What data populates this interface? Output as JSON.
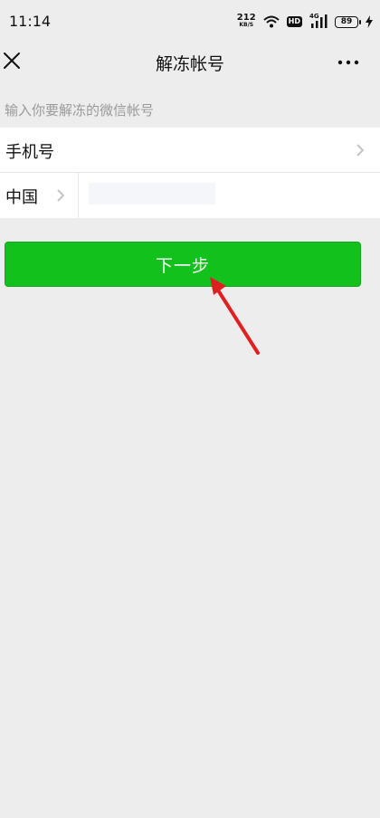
{
  "status_bar": {
    "time": "11:14",
    "net_speed": "212",
    "net_speed_unit": "KB/S",
    "hd": "HD",
    "signal_label": "4G",
    "battery": "89"
  },
  "nav": {
    "title": "解冻帐号"
  },
  "form": {
    "hint": "输入你要解冻的微信帐号",
    "method_label": "手机号",
    "country": "中国",
    "phone_value": "",
    "phone_placeholder": ""
  },
  "actions": {
    "next_label": "下一步"
  },
  "colors": {
    "background": "#ededed",
    "primary": "#13c11c",
    "annotation": "#e02020"
  },
  "icons": {
    "close": "close-icon",
    "more": "more-dots-icon",
    "chevron": "chevron-right-icon",
    "wifi": "wifi-icon",
    "signal": "signal-icon",
    "charging": "bolt-icon"
  }
}
